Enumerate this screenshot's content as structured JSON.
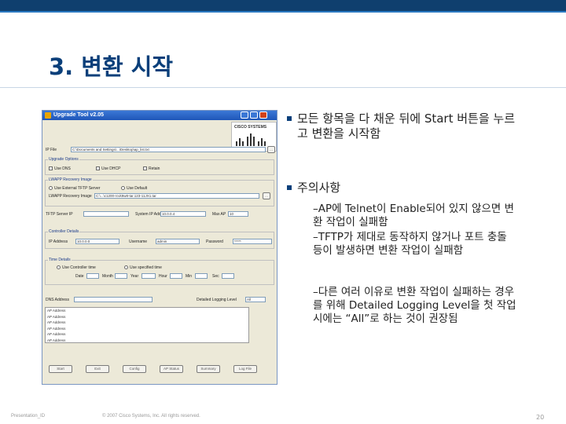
{
  "slide": {
    "title": "3. 변환 시작",
    "footer_left": "Presentation_ID",
    "footer_mid": "© 2007 Cisco Systems, Inc. All rights reserved.",
    "page_number": "20"
  },
  "bullets": [
    {
      "text": "모든 항목을 다 채운 뒤에 Start 버튼을 누르고 변환을 시작함"
    },
    {
      "text": "주의사항",
      "subs": [
        "–AP에 Telnet이 Enable되어 있지 않으면 변환 작업이 실패함",
        "–TFTP가 제대로 동작하지 않거나 포트 충돌 등이 발생하면 변환 작업이 실패함",
        "–다른 여러 이유로 변환 작업이 실패하는 경우를 위해 Detailed Logging Level을 첫 작업 시에는 “All”로 하는 것이 권장됨"
      ]
    }
  ],
  "window": {
    "title": "Upgrade Tool v2.05",
    "brand": "CISCO SYSTEMS",
    "ip_file_label": "IP File",
    "ip_file_value": "C:\\Documents and Settings\\...\\Desktop\\ap_list.txt",
    "browse_label": "...",
    "upgrade_options_title": "Upgrade Options",
    "opt1": "Use DNS",
    "opt2": "Use DHCP",
    "opt3": "Retain",
    "recovery_title": "LWAPP Recovery Image",
    "rec_opt1": "Use External TFTP Server",
    "rec_opt2": "Use Default",
    "recovery_image_label": "LWAPP Recovery Image",
    "recovery_image_value": "C:\\...\\c1200-rcvk9w8-tar.123-11JX1.tar",
    "tftp_label": "TFTP Server IP",
    "system_ip_label": "System IP Addr",
    "system_ip_value": "10.0.0.4",
    "max_ap_label": "Max AP",
    "max_ap_value": "10",
    "controller_title": "Controller Details",
    "ip_address_label": "IP Address",
    "ip_address_value": "10.0.0.0",
    "username_label": "Username",
    "username_value": "admin",
    "password_label": "Password",
    "password_value": "*****",
    "time_title": "Time Details",
    "time_opt1": "Use Controller time",
    "time_opt2": "Use specified time",
    "date_label": "Date",
    "month_label": "Month",
    "year_label": "Year",
    "hour_label": "Hour",
    "min_label": "Min",
    "sec_label": "Sec",
    "dns_label": "DNS Address",
    "logging_label": "Detailed Logging Level",
    "logging_value": "All",
    "ap_rows": [
      "AP Address",
      "AP Address",
      "AP Address",
      "AP Address",
      "AP Address",
      "AP Address"
    ],
    "buttons": [
      "Start",
      "Exit",
      "Config",
      "AP Status",
      "Summary",
      "Log File"
    ]
  },
  "colors": {
    "title": "#0a3f7a",
    "topbar": "#0f3f6e",
    "bullet": "#0a3f7a"
  }
}
